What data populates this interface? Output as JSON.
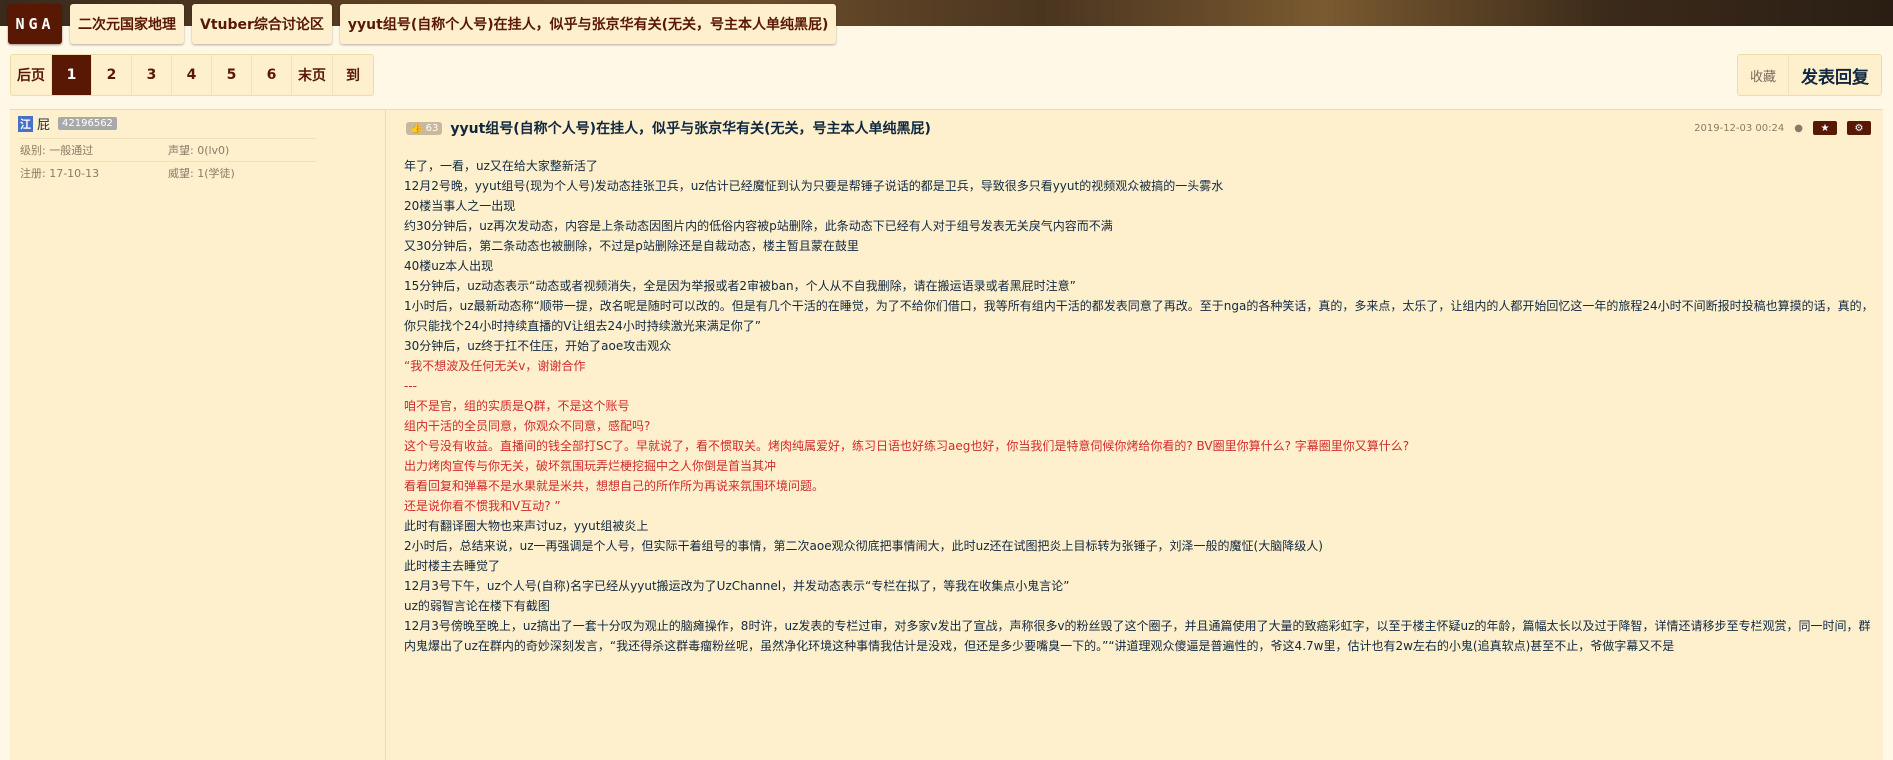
{
  "nav": {
    "logo": "NGA",
    "crumbs": [
      "二次元国家地理",
      "Vtuber综合讨论区",
      "yyut组号(自称个人号)在挂人，似乎与张京华有关(无关，号主本人单纯黑屁)"
    ]
  },
  "pager": {
    "prev": "后页",
    "pages": [
      "1",
      "2",
      "3",
      "4",
      "5",
      "6"
    ],
    "current": "1",
    "last": "末页",
    "goto": "到"
  },
  "actions": {
    "favorite": "收藏",
    "reply": "发表回复"
  },
  "user": {
    "badge": "江",
    "name": "屁",
    "uid": "42196562",
    "level_label": "级别: 一般通过",
    "reputation_label": "声望: 0(lv0)",
    "register_label": "注册: 17-10-13",
    "prestige_label": "威望: 1(学徒)"
  },
  "post": {
    "likes": "63",
    "title": "yyut组号(自称个人号)在挂人，似乎与张京华有关(无关，号主本人单纯黑屁)",
    "time": "2019-12-03 00:24",
    "lines": [
      {
        "text": "年了，一看，uz又在给大家整新活了",
        "color": "#10273f"
      },
      {
        "text": "12月2号晚，yyut组号(现为个人号)发动态挂张卫兵，uz估计已经魔怔到认为只要是帮锤子说话的都是卫兵，导致很多只看yyut的视频观众被搞的一头雾水",
        "color": "#10273f"
      },
      {
        "text": "20楼当事人之一出现",
        "color": "#10273f"
      },
      {
        "text": "约30分钟后，uz再次发动态，内容是上条动态因图片内的低俗内容被p站删除，此条动态下已经有人对于组号发表无关戾气内容而不满",
        "color": "#10273f"
      },
      {
        "text": "又30分钟后，第二条动态也被删除，不过是p站删除还是自裁动态，楼主暂且蒙在鼓里",
        "color": "#10273f"
      },
      {
        "text": "40楼uz本人出现",
        "color": "#10273f"
      },
      {
        "text": "15分钟后，uz动态表示“动态或者视频消失，全是因为举报或者2审被ban，个人从不自我删除，请在搬运语录或者黑屁时注意”",
        "color": "#10273f"
      },
      {
        "text": "1小时后，uz最新动态称“顺带一提，改名呢是随时可以改的。但是有几个干活的在睡觉，为了不给你们借口，我等所有组内干活的都发表同意了再改。至于nga的各种笑话，真的，多来点，太乐了，让组内的人都开始回忆这一年的旅程24小时不间断报时投稿也算摸的话，真的，你只能找个24小时持续直播的V让组去24小时持续激光来满足你了”",
        "color": "#10273f"
      },
      {
        "text": "30分钟后，uz终于扛不住压，开始了aoe攻击观众",
        "color": "#10273f"
      },
      {
        "text": "“我不想波及任何无关v，谢谢合作",
        "color": "#d02b2b"
      },
      {
        "text": "---",
        "color": "#d02b2b"
      },
      {
        "text": "咱不是官，组的实质是Q群，不是这个账号",
        "color": "#d02b2b"
      },
      {
        "text": "组内干活的全员同意，你观众不同意，感配吗?",
        "color": "#d02b2b"
      },
      {
        "text": "这个号没有收益。直播间的钱全部打SC了。早就说了，看不惯取关。烤肉纯属爱好，练习日语也好练习aeg也好，你当我们是特意伺候你烤给你看的? BV圈里你算什么? 字幕圈里你又算什么?",
        "color": "#d02b2b"
      },
      {
        "text": "出力烤肉宣传与你无关，破坏氛围玩弄烂梗挖掘中之人你倒是首当其冲",
        "color": "#d02b2b"
      },
      {
        "text": "看看回复和弹幕不是水果就是米共，想想自己的所作所为再说来氛围环境问题。",
        "color": "#d02b2b"
      },
      {
        "text": "还是说你看不惯我和V互动? ”",
        "color": "#d02b2b"
      },
      {
        "text": "此时有翻译圈大物也来声讨uz，yyut组被炎上",
        "color": "#10273f"
      },
      {
        "text": "2小时后，总结来说，uz一再强调是个人号，但实际干着组号的事情，第二次aoe观众彻底把事情闹大，此时uz还在试图把炎上目标转为张锤子，刘泽一般的魔怔(大脑降级人)",
        "color": "#10273f"
      },
      {
        "text": "此时楼主去睡觉了",
        "color": "#10273f"
      },
      {
        "text": "12月3号下午，uz个人号(自称)名字已经从yyut搬运改为了UzChannel，并发动态表示“专栏在拟了，等我在收集点小鬼言论”",
        "color": "#10273f"
      },
      {
        "text": "uz的弱智言论在楼下有截图",
        "color": "#10273f"
      },
      {
        "text": "12月3号傍晚至晚上，uz搞出了一套十分叹为观止的脑瘫操作，8时许，uz发表的专栏过审，对多家v发出了宣战，声称很多v的粉丝毁了这个圈子，并且通篇使用了大量的致癌彩虹字，以至于楼主怀疑uz的年龄，篇幅太长以及过于降智，详情还请移步至专栏观赏，同一时间，群内鬼爆出了uz在群内的奇妙深刻发言，“我还得杀这群毒瘤粉丝呢，虽然净化环境这种事情我估计是没戏，但还是多少要嘴臭一下的。”“讲道理观众傻逼是普遍性的，爷这4.7w里，估计也有2w左右的小鬼(追真软点)甚至不止，爷做字幕又不是",
        "color": "#10273f"
      }
    ]
  },
  "colors": {
    "accent": "#591804",
    "text": "#10273f",
    "quote": "#d02b2b",
    "bg": "#fff8e7",
    "panel": "#fff0cd"
  },
  "icons": {
    "like": "thumbs-up-icon",
    "fav": "star-icon",
    "settings": "gear-icon",
    "ghost": "ghost-icon"
  }
}
